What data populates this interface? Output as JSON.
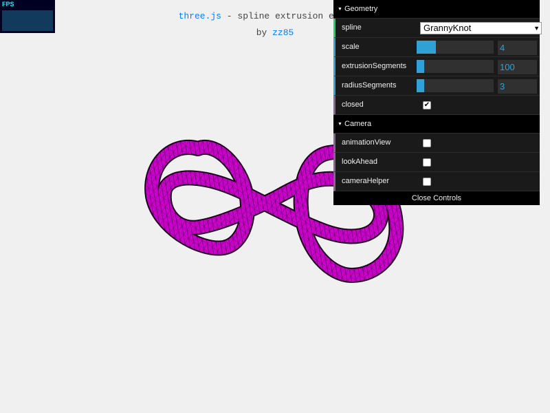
{
  "stats": {
    "label": "FPS"
  },
  "info": {
    "link_text": "three.js",
    "title_suffix": " - spline extrusion examples",
    "by_prefix": "by ",
    "author": "zz85"
  },
  "colors": {
    "mesh": "#cc00cc",
    "wire": "#000000",
    "link": "#0080ff",
    "slider_fill": "#2fa1d6"
  },
  "gui": {
    "geometry_folder": "Geometry",
    "spline_label": "spline",
    "spline_value": "GrannyKnot",
    "scale_label": "scale",
    "scale_value": "4",
    "scale_fraction": 0.25,
    "extrusion_label": "extrusionSegments",
    "extrusion_value": "100",
    "extrusion_fraction": 0.1,
    "radius_label": "radiusSegments",
    "radius_value": "3",
    "radius_fraction": 0.1,
    "closed_label": "closed",
    "closed_checked": true,
    "camera_folder": "Camera",
    "animation_label": "animationView",
    "animation_checked": false,
    "lookahead_label": "lookAhead",
    "lookahead_checked": false,
    "helper_label": "cameraHelper",
    "helper_checked": false,
    "close_button": "Close Controls"
  }
}
